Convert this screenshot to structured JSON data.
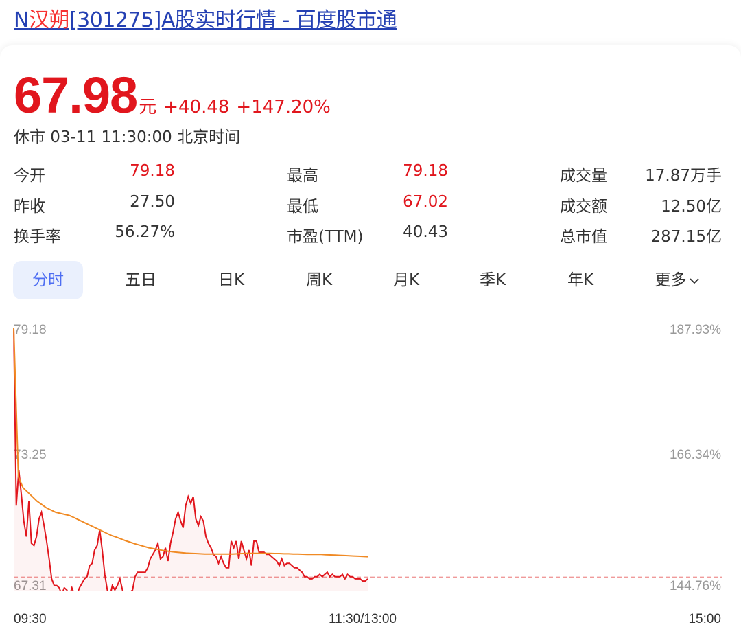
{
  "header": {
    "title_prefix": "N",
    "title_highlight": "汉朔",
    "title_suffix": "[301275]A股实时行情 - 百度股市通"
  },
  "quote": {
    "price": "67.98",
    "unit": "元",
    "change": "+40.48",
    "change_pct": "+147.20%",
    "status": "休市 03-11 11:30:00 北京时间"
  },
  "stats": [
    {
      "label": "今开",
      "value": "79.18",
      "color": "#e1161d"
    },
    {
      "label": "最高",
      "value": "79.18",
      "color": "#e1161d"
    },
    {
      "label": "成交量",
      "value": "17.87万手",
      "color": "#333333"
    },
    {
      "label": "昨收",
      "value": "27.50",
      "color": "#333333"
    },
    {
      "label": "最低",
      "value": "67.02",
      "color": "#e1161d"
    },
    {
      "label": "成交额",
      "value": "12.50亿",
      "color": "#333333"
    },
    {
      "label": "换手率",
      "value": "56.27%",
      "color": "#333333"
    },
    {
      "label": "市盈(TTM)",
      "value": "40.43",
      "color": "#333333"
    },
    {
      "label": "总市值",
      "value": "287.15亿",
      "color": "#333333"
    }
  ],
  "tabs": [
    {
      "label": "分时",
      "active": true
    },
    {
      "label": "五日",
      "active": false
    },
    {
      "label": "日K",
      "active": false
    },
    {
      "label": "周K",
      "active": false
    },
    {
      "label": "月K",
      "active": false
    },
    {
      "label": "季K",
      "active": false
    },
    {
      "label": "年K",
      "active": false
    },
    {
      "label": "更多",
      "active": false
    }
  ],
  "colors": {
    "accent": "#4e6ef2",
    "up_red": "#e1161d",
    "avg_line": "#f08a24",
    "link_blue": "#2440b3"
  },
  "chart_data": {
    "type": "line",
    "y_left_ticks": [
      "79.18",
      "73.25",
      "67.31"
    ],
    "y_right_ticks": [
      "187.93%",
      "166.34%",
      "144.76%"
    ],
    "ylim": [
      67.31,
      79.18
    ],
    "x_ticks": [
      "09:30",
      "11:30/13:00",
      "15:00"
    ],
    "reference_line": 67.98,
    "series": [
      {
        "key": "price",
        "values": [
          79.18,
          71.2,
          72.8,
          71.7,
          70.5,
          69.8,
          71.4,
          69.5,
          69.4,
          69.8,
          70.6,
          70.9,
          70.3,
          69.6,
          68.8,
          67.9,
          67.6,
          67.6,
          67.5,
          67.2,
          67.5,
          67.4,
          67.1,
          67.5,
          67.2,
          67.2,
          67.5,
          67.7,
          67.9,
          68.0,
          68.5,
          68.6,
          69.2,
          69.4,
          70.1,
          69.2,
          68.1,
          67.4,
          67.1,
          67.6,
          67.4,
          67.6,
          67.9,
          67.4,
          67.2,
          67.2,
          67.3,
          67.4,
          68.0,
          68.2,
          68.2,
          68.2,
          68.2,
          68.4,
          68.8,
          69.0,
          69.2,
          69.5,
          68.8,
          68.9,
          69.3,
          68.7,
          69.5,
          70.0,
          70.6,
          70.9,
          70.5,
          70.2,
          71.2,
          71.6,
          71.3,
          71.6,
          70.6,
          70.3,
          70.7,
          70.5,
          69.8,
          69.5,
          69.3,
          69.0,
          68.9,
          68.6,
          68.9,
          68.6,
          68.4,
          68.4,
          69.6,
          69.3,
          69.6,
          68.8,
          69.6,
          69.2,
          68.8,
          69.2,
          68.5,
          69.6,
          69.6,
          69.1,
          69.1,
          69.1,
          69.0,
          69.0,
          68.9,
          68.8,
          68.7,
          68.5,
          68.8,
          68.5,
          68.6,
          68.6,
          68.5,
          68.4,
          68.4,
          68.3,
          68.2,
          68.0,
          68.0,
          67.9,
          67.9,
          68.0,
          68.0,
          68.1,
          68.0,
          68.1,
          68.2,
          68.0,
          68.1,
          68.0,
          68.0,
          68.0,
          68.1,
          67.9,
          68.1,
          68.0,
          68.0,
          67.9,
          67.9,
          67.9,
          67.8,
          67.8,
          67.9
        ]
      },
      {
        "key": "average",
        "values": [
          79.18,
          72.5,
          72.0,
          71.8,
          71.6,
          71.4,
          71.25,
          71.1,
          71.0,
          70.9,
          70.85,
          70.8,
          70.75,
          70.65,
          70.55,
          70.45,
          70.35,
          70.25,
          70.15,
          70.05,
          69.95,
          69.85,
          69.78,
          69.7,
          69.62,
          69.55,
          69.48,
          69.42,
          69.36,
          69.3,
          69.26,
          69.22,
          69.18,
          69.15,
          69.12,
          69.1,
          69.08,
          69.06,
          69.05,
          69.04,
          69.03,
          69.02,
          69.02,
          69.02,
          69.02,
          69.02,
          69.02,
          69.02,
          69.03,
          69.04,
          69.05,
          69.05,
          69.05,
          69.05,
          69.05,
          69.05,
          69.04,
          69.04,
          69.03,
          69.03,
          69.02,
          69.02,
          69.01,
          69.0,
          69.0,
          69.0,
          69.0,
          68.99,
          68.98,
          68.97,
          68.96,
          68.95,
          68.94,
          68.93,
          68.92,
          68.91,
          68.9
        ]
      }
    ]
  }
}
